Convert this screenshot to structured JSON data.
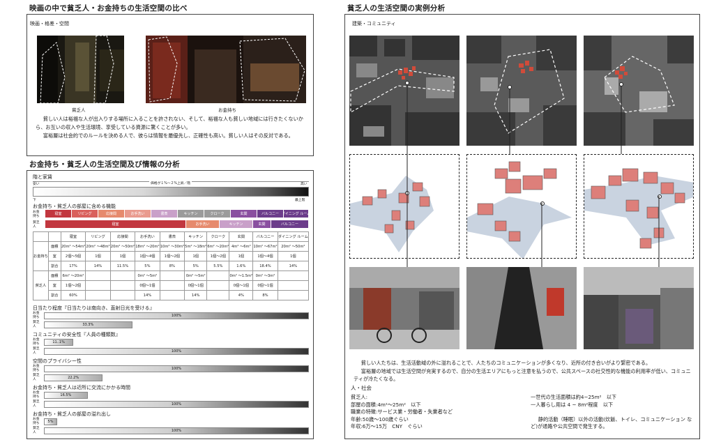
{
  "left": {
    "section1_title": "映画の中で貧乏人・お金持ちの生活空間の比べ",
    "section1_sub": "映画・格差・空間",
    "cap_poor": "貧乏人",
    "cap_rich": "お金持ち",
    "para1": "貧しい人は裕福な人が出入りする場所に入ることを許されない、そして、裕福な人も貧しい地域には行きたくないから、お互いの収入や生活環境、享受している資源に驚くことが多い。",
    "para2": "富裕層は社会的でのルールを決める人で、彼らは情報を最優先し、正確性も高い。貧しい人はその反対である。",
    "section2_title": "お金持ち・貧乏人の生活空間及び情報の分析",
    "rent_title": "階と家賃",
    "rent_note": "価格が１%〜２%上昇／階",
    "rent_low": "安い",
    "rent_high": "高い",
    "floor_low": "下",
    "floor_high": "最上階",
    "func_title": "お金持ち・貧乏人の部屋に含める機能",
    "row_rich": "お金持ち",
    "row_poor": "貧乏人",
    "rich_features": [
      "寝室",
      "リビング",
      "応接間",
      "お手洗い",
      "書斎",
      "キッチン",
      "クローク",
      "玄関",
      "バルコニー",
      "ダイニング ルーム"
    ],
    "poor_features": [
      "寝室",
      "お手洗い",
      "キッチン",
      "玄関",
      "バルコニー"
    ],
    "table_headers": [
      "寝室",
      "リビング",
      "応接間",
      "お手洗い",
      "書斎",
      "キッチン",
      "クローク",
      "玄関",
      "バルコニー",
      "ダイニング ルーム"
    ],
    "table_row_labels": [
      "面積",
      "室",
      "割合"
    ],
    "rich_area": [
      "20m² 〜54m²",
      "20m² 〜48m²",
      "20m² 〜50m²",
      "18m² 〜20m²",
      "10m² 〜30m²",
      "5m² 〜18m²",
      "6m² 〜20m²",
      "4m² 〜6m²",
      "10m² 〜67m²",
      "20m² 〜50m²"
    ],
    "rich_rooms": [
      "2個〜5個",
      "1個",
      "1個",
      "1個〜4個",
      "1個〜2個",
      "1個",
      "1個〜2個",
      "1個",
      "1個〜4個",
      "1個"
    ],
    "rich_ratio": [
      "17%",
      "14%",
      "11.5%",
      "5%",
      "8%",
      "5%",
      "5.5%",
      "1.6%",
      "18.4%",
      "14%"
    ],
    "poor_area": [
      "6m² 〜20m²",
      "",
      "",
      "0m² 〜5m²",
      "",
      "0m² 〜5m²",
      "",
      "0m² 〜1.5m²",
      "0m² 〜3m²",
      ""
    ],
    "poor_rooms": [
      "1個〜2個",
      "",
      "",
      "0個〜1個",
      "",
      "0個〜1個",
      "",
      "0個〜1個",
      "0個〜1個",
      ""
    ],
    "poor_ratio": [
      "60%",
      "",
      "",
      "14%",
      "",
      "14%",
      "",
      "4%",
      "8%",
      ""
    ],
    "bars": [
      {
        "title": "日当たり程度『日当たりは南向き、直射日光を受ける』",
        "rich": "100%",
        "poor": "33.3%",
        "rich_v": 1.0,
        "poor_v": 0.333
      },
      {
        "title": "コミュニティの安全性『人員の種類数』",
        "rich": "11..1%",
        "poor": "100%",
        "rich_v": 0.111,
        "poor_v": 1.0
      },
      {
        "title": "空間のプライバシー性",
        "rich": "100%",
        "poor": "22.2%",
        "rich_v": 1.0,
        "poor_v": 0.222
      },
      {
        "title": "お金持ち・貧乏人は近所に交流にかかる時間",
        "rich": "16.5%",
        "poor": "100%",
        "rich_v": 0.165,
        "poor_v": 1.0
      },
      {
        "title": "お金持ち・貧乏人の部屋の溢れ出し",
        "rich": "5%",
        "poor": "100%",
        "rich_v": 0.05,
        "poor_v": 1.0
      }
    ]
  },
  "right": {
    "title": "貧乏人の生活空間の実例分析",
    "sub": "建築・コミュニティ",
    "para1": "貧しい人たちは、生活活動域の外に溢れることで、人たちのコミュニケーションが多くなり、近所の付き合いがより緊密である。",
    "para2": "富裕層の地域では生活空間が充実するので、自分の生活エリアにもっと注意を払うので、公共スペースの社交性的な機能の利用率が低い、コミュニティが冷たくなる。",
    "social_title": "人・社会",
    "col1": [
      "貧乏人:",
      "部屋の面積:4m²〜25m²　以下",
      "職業の特徴:サービス業・労働者・失業者など",
      "年齢:50歳〜100歳ぐらい",
      "年収:6万〜15万　CNY　ぐらい"
    ],
    "col2": [
      "一世代の生活面積は約4~25m²　以下",
      "一人暮らし用は 4 ~ 8m²程度　以下",
      "",
      "静的活動（睡眠）以外の活動(炊飯、トイレ、コミュニケーション など)が通路や公共空間で発生する。"
    ]
  },
  "colors": {
    "feat1": "#c2373f",
    "feat2": "#d9605c",
    "feat3": "#e68a6d",
    "feat4": "#e99a8e",
    "feat5": "#c9a0c9",
    "feat6": "#9b9b9b",
    "feat7": "#8a4fa0",
    "feat8": "#6c3d8b",
    "building": "#dd7f7a",
    "road": "#c9d3e0"
  }
}
